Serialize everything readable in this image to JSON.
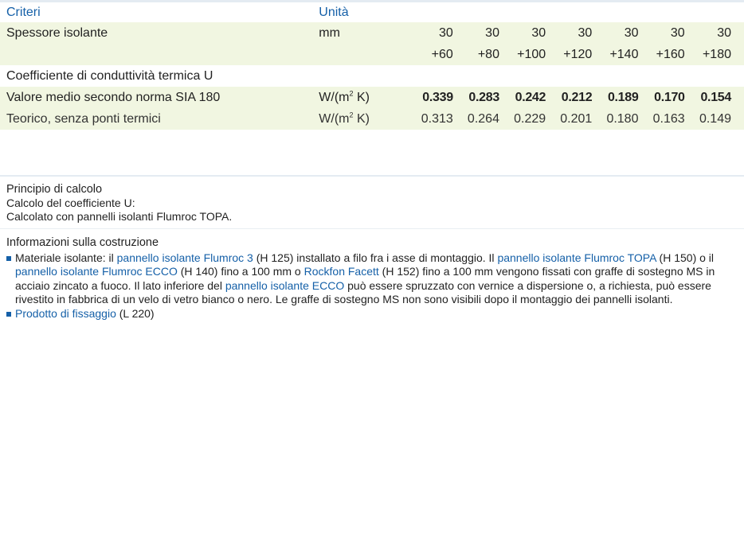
{
  "table": {
    "header": {
      "criteria": "Criteri",
      "unit": "Unità"
    },
    "rows": [
      {
        "label": "Spessore isolante",
        "unit": "mm",
        "values": [
          "30",
          "30",
          "30",
          "30",
          "30",
          "30",
          "30"
        ]
      },
      {
        "label": "",
        "unit": "",
        "values": [
          "+60",
          "+80",
          "+100",
          "+120",
          "+140",
          "+160",
          "+180"
        ]
      },
      {
        "label": "Coefficiente di conduttività termica U",
        "unit": "",
        "values": [
          "",
          "",
          "",
          "",
          "",
          "",
          ""
        ]
      },
      {
        "label": "Valore medio secondo norma SIA 180",
        "unit_base": "W/(m",
        "unit_exp": "2",
        "unit_tail": " K)",
        "values": [
          "0.339",
          "0.283",
          "0.242",
          "0.212",
          "0.189",
          "0.170",
          "0.154"
        ]
      },
      {
        "label": "Teorico, senza ponti termici",
        "unit_base": "W/(m",
        "unit_exp": "2",
        "unit_tail": " K)",
        "values": [
          "0.313",
          "0.264",
          "0.229",
          "0.201",
          "0.180",
          "0.163",
          "0.149"
        ]
      }
    ]
  },
  "calc": {
    "title": "Principio di calcolo",
    "line1": "Calcolo del coefficiente U:",
    "line2": "Calcolato con pannelli isolanti Flumroc TOPA."
  },
  "construction": {
    "title": "Informazioni sulla costruzione",
    "b1": {
      "t1": "Materiale isolante: il ",
      "l1": "pannello isolante Flumroc 3",
      "t2": " (H 125) installato a filo fra i asse di montaggio. Il ",
      "l2": "pannello isolante Flumroc TOPA",
      "t3": " (H 150) o il ",
      "l3": "pannello isolante Flumroc ECCO",
      "t4": " (H 140) fino a 100 mm o ",
      "l4": "Rockfon Facett",
      "t5": " (H 152) fino a 100 mm vengono fissati con graffe di sostegno MS in acciaio zincato a fuoco. Il lato inferiore del ",
      "l5": "pannello isolante ECCO",
      "t6": " può essere spruzzato con vernice a dispersione o, a richiesta, può essere rivestito in fabbrica di un velo di vetro bianco o nero. Le graffe di sostegno MS non sono visibili dopo il montaggio dei pannelli isolanti."
    },
    "b2": {
      "l1": "Prodotto di fissaggio",
      "t1": " (L 220)"
    }
  },
  "colors": {
    "accent": "#1560a8",
    "row_highlight": "#f1f6e1",
    "divider": "#e4ebf2"
  }
}
